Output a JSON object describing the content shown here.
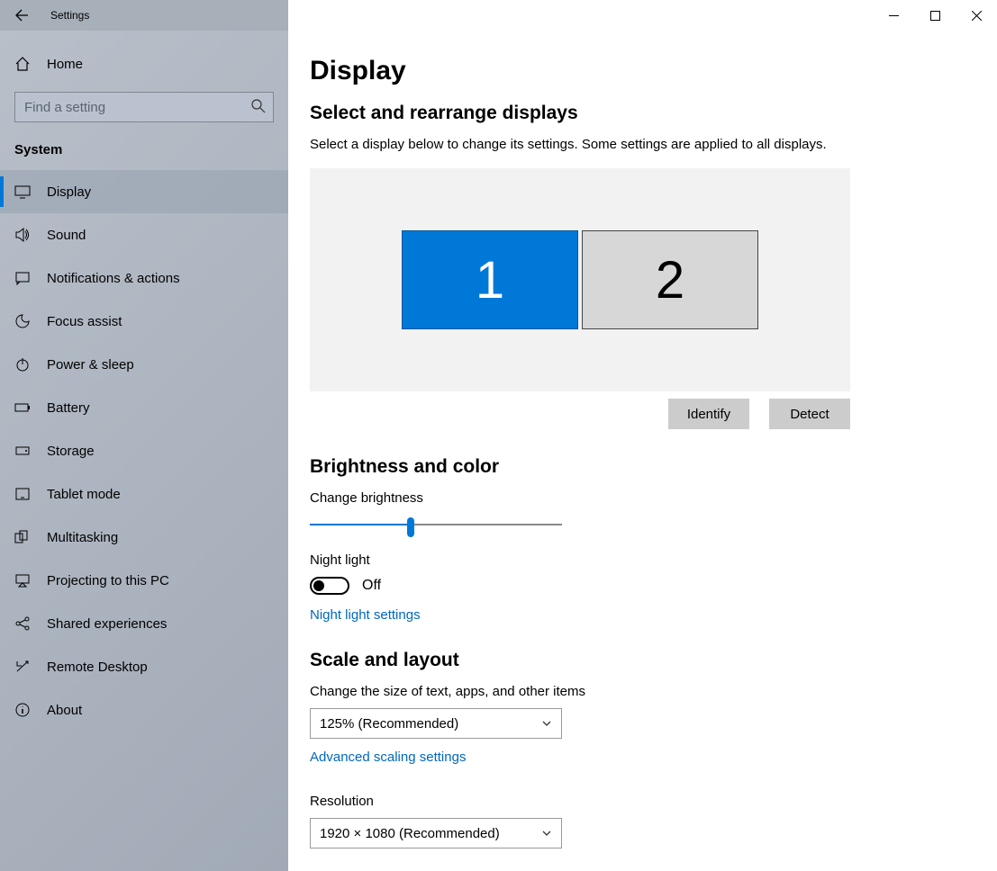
{
  "window": {
    "title": "Settings"
  },
  "sidebar": {
    "home_label": "Home",
    "search_placeholder": "Find a setting",
    "group_label": "System",
    "items": [
      {
        "label": "Display"
      },
      {
        "label": "Sound"
      },
      {
        "label": "Notifications & actions"
      },
      {
        "label": "Focus assist"
      },
      {
        "label": "Power & sleep"
      },
      {
        "label": "Battery"
      },
      {
        "label": "Storage"
      },
      {
        "label": "Tablet mode"
      },
      {
        "label": "Multitasking"
      },
      {
        "label": "Projecting to this PC"
      },
      {
        "label": "Shared experiences"
      },
      {
        "label": "Remote Desktop"
      },
      {
        "label": "About"
      }
    ]
  },
  "page": {
    "title": "Display",
    "arrange_heading": "Select and rearrange displays",
    "arrange_help": "Select a display below to change its settings. Some settings are applied to all displays.",
    "monitors": {
      "m1": "1",
      "m2": "2"
    },
    "identify_label": "Identify",
    "detect_label": "Detect",
    "brightness_heading": "Brightness and color",
    "brightness_label": "Change brightness",
    "brightness_percent": 40,
    "nightlight_label": "Night light",
    "nightlight_state": "Off",
    "nightlight_link": "Night light settings",
    "scale_heading": "Scale and layout",
    "scale_label": "Change the size of text, apps, and other items",
    "scale_value": "125% (Recommended)",
    "advanced_scaling_link": "Advanced scaling settings",
    "resolution_label": "Resolution",
    "resolution_value": "1920 × 1080 (Recommended)"
  }
}
